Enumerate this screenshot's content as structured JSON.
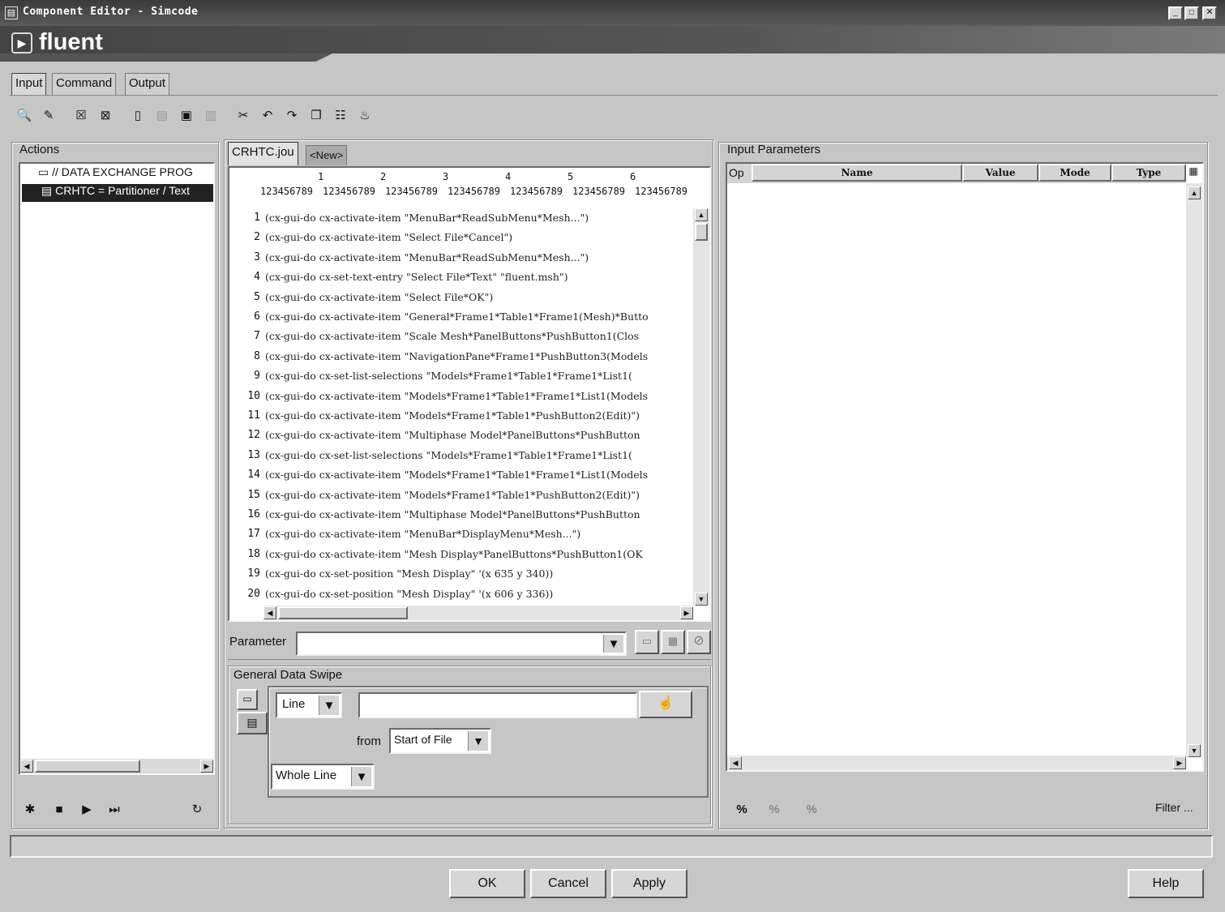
{
  "window": {
    "title": "Component Editor - Simcode",
    "header": "fluent"
  },
  "tabs": [
    "Input",
    "Command",
    "Output"
  ],
  "actions": {
    "title": "Actions",
    "items": [
      "// DATA EXCHANGE PROG",
      "CRHTC = Partitioner / Text"
    ]
  },
  "editor": {
    "tabs": [
      "CRHTC.jou",
      "<New>"
    ],
    "ruler_numbers": [
      "1",
      "2",
      "3",
      "4",
      "5",
      "6"
    ],
    "ruler_digits": [
      "123456789",
      "123456789",
      "123456789",
      "123456789",
      "123456789",
      "123456789",
      "123456789"
    ],
    "lines": [
      {
        "n": "1",
        "t": "(cx-gui-do cx-activate-item \"MenuBar*ReadSubMenu*Mesh...\")"
      },
      {
        "n": "2",
        "t": "(cx-gui-do cx-activate-item \"Select File*Cancel\")"
      },
      {
        "n": "3",
        "t": "(cx-gui-do cx-activate-item \"MenuBar*ReadSubMenu*Mesh...\")"
      },
      {
        "n": "4",
        "t": "(cx-gui-do cx-set-text-entry \"Select File*Text\" \"fluent.msh\")"
      },
      {
        "n": "5",
        "t": "(cx-gui-do cx-activate-item \"Select File*OK\")"
      },
      {
        "n": "6",
        "t": "(cx-gui-do cx-activate-item \"General*Frame1*Table1*Frame1(Mesh)*Butto"
      },
      {
        "n": "7",
        "t": "(cx-gui-do cx-activate-item \"Scale Mesh*PanelButtons*PushButton1(Clos"
      },
      {
        "n": "8",
        "t": "(cx-gui-do cx-activate-item \"NavigationPane*Frame1*PushButton3(Models"
      },
      {
        "n": "9",
        "t": "(cx-gui-do cx-set-list-selections \"Models*Frame1*Table1*Frame1*List1("
      },
      {
        "n": "10",
        "t": "(cx-gui-do cx-activate-item \"Models*Frame1*Table1*Frame1*List1(Models"
      },
      {
        "n": "11",
        "t": "(cx-gui-do cx-activate-item \"Models*Frame1*Table1*PushButton2(Edit)\")"
      },
      {
        "n": "12",
        "t": "(cx-gui-do cx-activate-item \"Multiphase Model*PanelButtons*PushButton"
      },
      {
        "n": "13",
        "t": "(cx-gui-do cx-set-list-selections \"Models*Frame1*Table1*Frame1*List1("
      },
      {
        "n": "14",
        "t": "(cx-gui-do cx-activate-item \"Models*Frame1*Table1*Frame1*List1(Models"
      },
      {
        "n": "15",
        "t": "(cx-gui-do cx-activate-item \"Models*Frame1*Table1*PushButton2(Edit)\")"
      },
      {
        "n": "16",
        "t": "(cx-gui-do cx-activate-item \"Multiphase Model*PanelButtons*PushButton"
      },
      {
        "n": "17",
        "t": "(cx-gui-do cx-activate-item \"MenuBar*DisplayMenu*Mesh...\")"
      },
      {
        "n": "18",
        "t": "(cx-gui-do cx-activate-item \"Mesh Display*PanelButtons*PushButton1(OK"
      },
      {
        "n": "19",
        "t": "(cx-gui-do cx-set-position \"Mesh Display\" '(x 635 y 340))"
      },
      {
        "n": "20",
        "t": "(cx-gui-do cx-set-position \"Mesh Display\" '(x 606 y 336))"
      }
    ]
  },
  "parameter": {
    "label": "Parameter",
    "value": ""
  },
  "swipe": {
    "title": "General Data Swipe",
    "mode": "Line",
    "text_value": "",
    "from_label": "from",
    "from_value": "Start of File",
    "scope": "Whole Line"
  },
  "input_params": {
    "title": "Input Parameters",
    "columns": [
      "Op",
      "Name",
      "Value",
      "Mode",
      "Type"
    ],
    "filter_label": "Filter ..."
  },
  "buttons": {
    "ok": "OK",
    "cancel": "Cancel",
    "apply": "Apply",
    "help": "Help"
  }
}
